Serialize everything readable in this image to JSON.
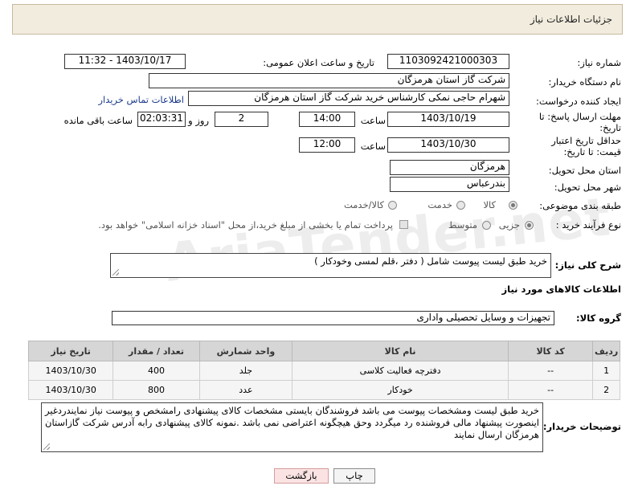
{
  "header": {
    "title": "جزئیات اطلاعات نیاز"
  },
  "fields": {
    "need_number": {
      "label": "شماره نیاز:",
      "value": "1103092421000303"
    },
    "announce_datetime": {
      "label": "تاریخ و ساعت اعلان عمومی:",
      "value": "1403/10/17 - 11:32"
    },
    "buyer_org": {
      "label": "نام دستگاه خریدار:",
      "value": "شرکت گاز استان هرمزگان"
    },
    "requester": {
      "label": "ایجاد کننده درخواست:",
      "value": "شهرام حاجی نمکی کارشناس خرید شرکت گاز استان هرمزگان",
      "contact_link": "اطلاعات تماس خریدار"
    },
    "reply_deadline": {
      "label": "مهلت ارسال پاسخ: تا تاریخ:",
      "date": "1403/10/19",
      "time_label": "ساعت",
      "time": "14:00",
      "days": "2",
      "days_label": "روز و",
      "remaining": "02:03:31",
      "remaining_label": "ساعت باقی مانده"
    },
    "price_validity": {
      "label": "حداقل تاریخ اعتبار قیمت: تا تاریخ:",
      "date": "1403/10/30",
      "time_label": "ساعت",
      "time": "12:00"
    },
    "province": {
      "label": "استان محل تحویل:",
      "value": "هرمزگان"
    },
    "city": {
      "label": "شهر محل تحویل:",
      "value": "بندرعباس"
    },
    "category": {
      "label": "طبقه بندی موضوعی:",
      "options": [
        "کالا",
        "خدمت",
        "کالا/خدمت"
      ],
      "selected": "کالا"
    },
    "process": {
      "label": "نوع فرآیند خرید :",
      "options": [
        "جزیی",
        "متوسط"
      ],
      "selected": "جزیی",
      "note": "پرداخت تمام یا بخشی از مبلغ خرید،از محل \"اسناد خزانه اسلامی\" خواهد بود."
    }
  },
  "summary": {
    "label": "شرح کلی نیاز:",
    "value": "خرید طبق لیست پیوست شامل ( دفتر ،قلم لمسی وخودکار )"
  },
  "goods_section": {
    "title": "اطلاعات کالاهای مورد نیاز"
  },
  "goods_group": {
    "label": "گروه کالا:",
    "value": "تجهیزات و وسایل تحصیلی واداری"
  },
  "table": {
    "headers": [
      "ردیف",
      "کد کالا",
      "نام کالا",
      "واحد شمارش",
      "تعداد / مقدار",
      "تاریخ نیاز"
    ],
    "rows": [
      [
        "1",
        "--",
        "دفترچه فعالیت کلاسی",
        "جلد",
        "400",
        "1403/10/30"
      ],
      [
        "2",
        "--",
        "خودکار",
        "عدد",
        "800",
        "1403/10/30"
      ]
    ]
  },
  "buyer_notes": {
    "label": "توضیحات خریدار:",
    "value": "خرید طبق لیست ومشخصات پیوست می باشد فروشندگان بایستی مشخصات کالای پیشنهادی رامشخص و پیوست نیاز نمایندردغیر اینصورت پیشنهاد مالی فروشنده رد میگردد وحق هیچگونه اعتراضی نمی باشد .نمونه کالای پیشنهادی رابه آدرس شرکت گازاستان هرمزگان ارسال نمایند"
  },
  "buttons": {
    "print": "چاپ",
    "back": "بازگشت"
  },
  "watermark": "AriaTender.net"
}
